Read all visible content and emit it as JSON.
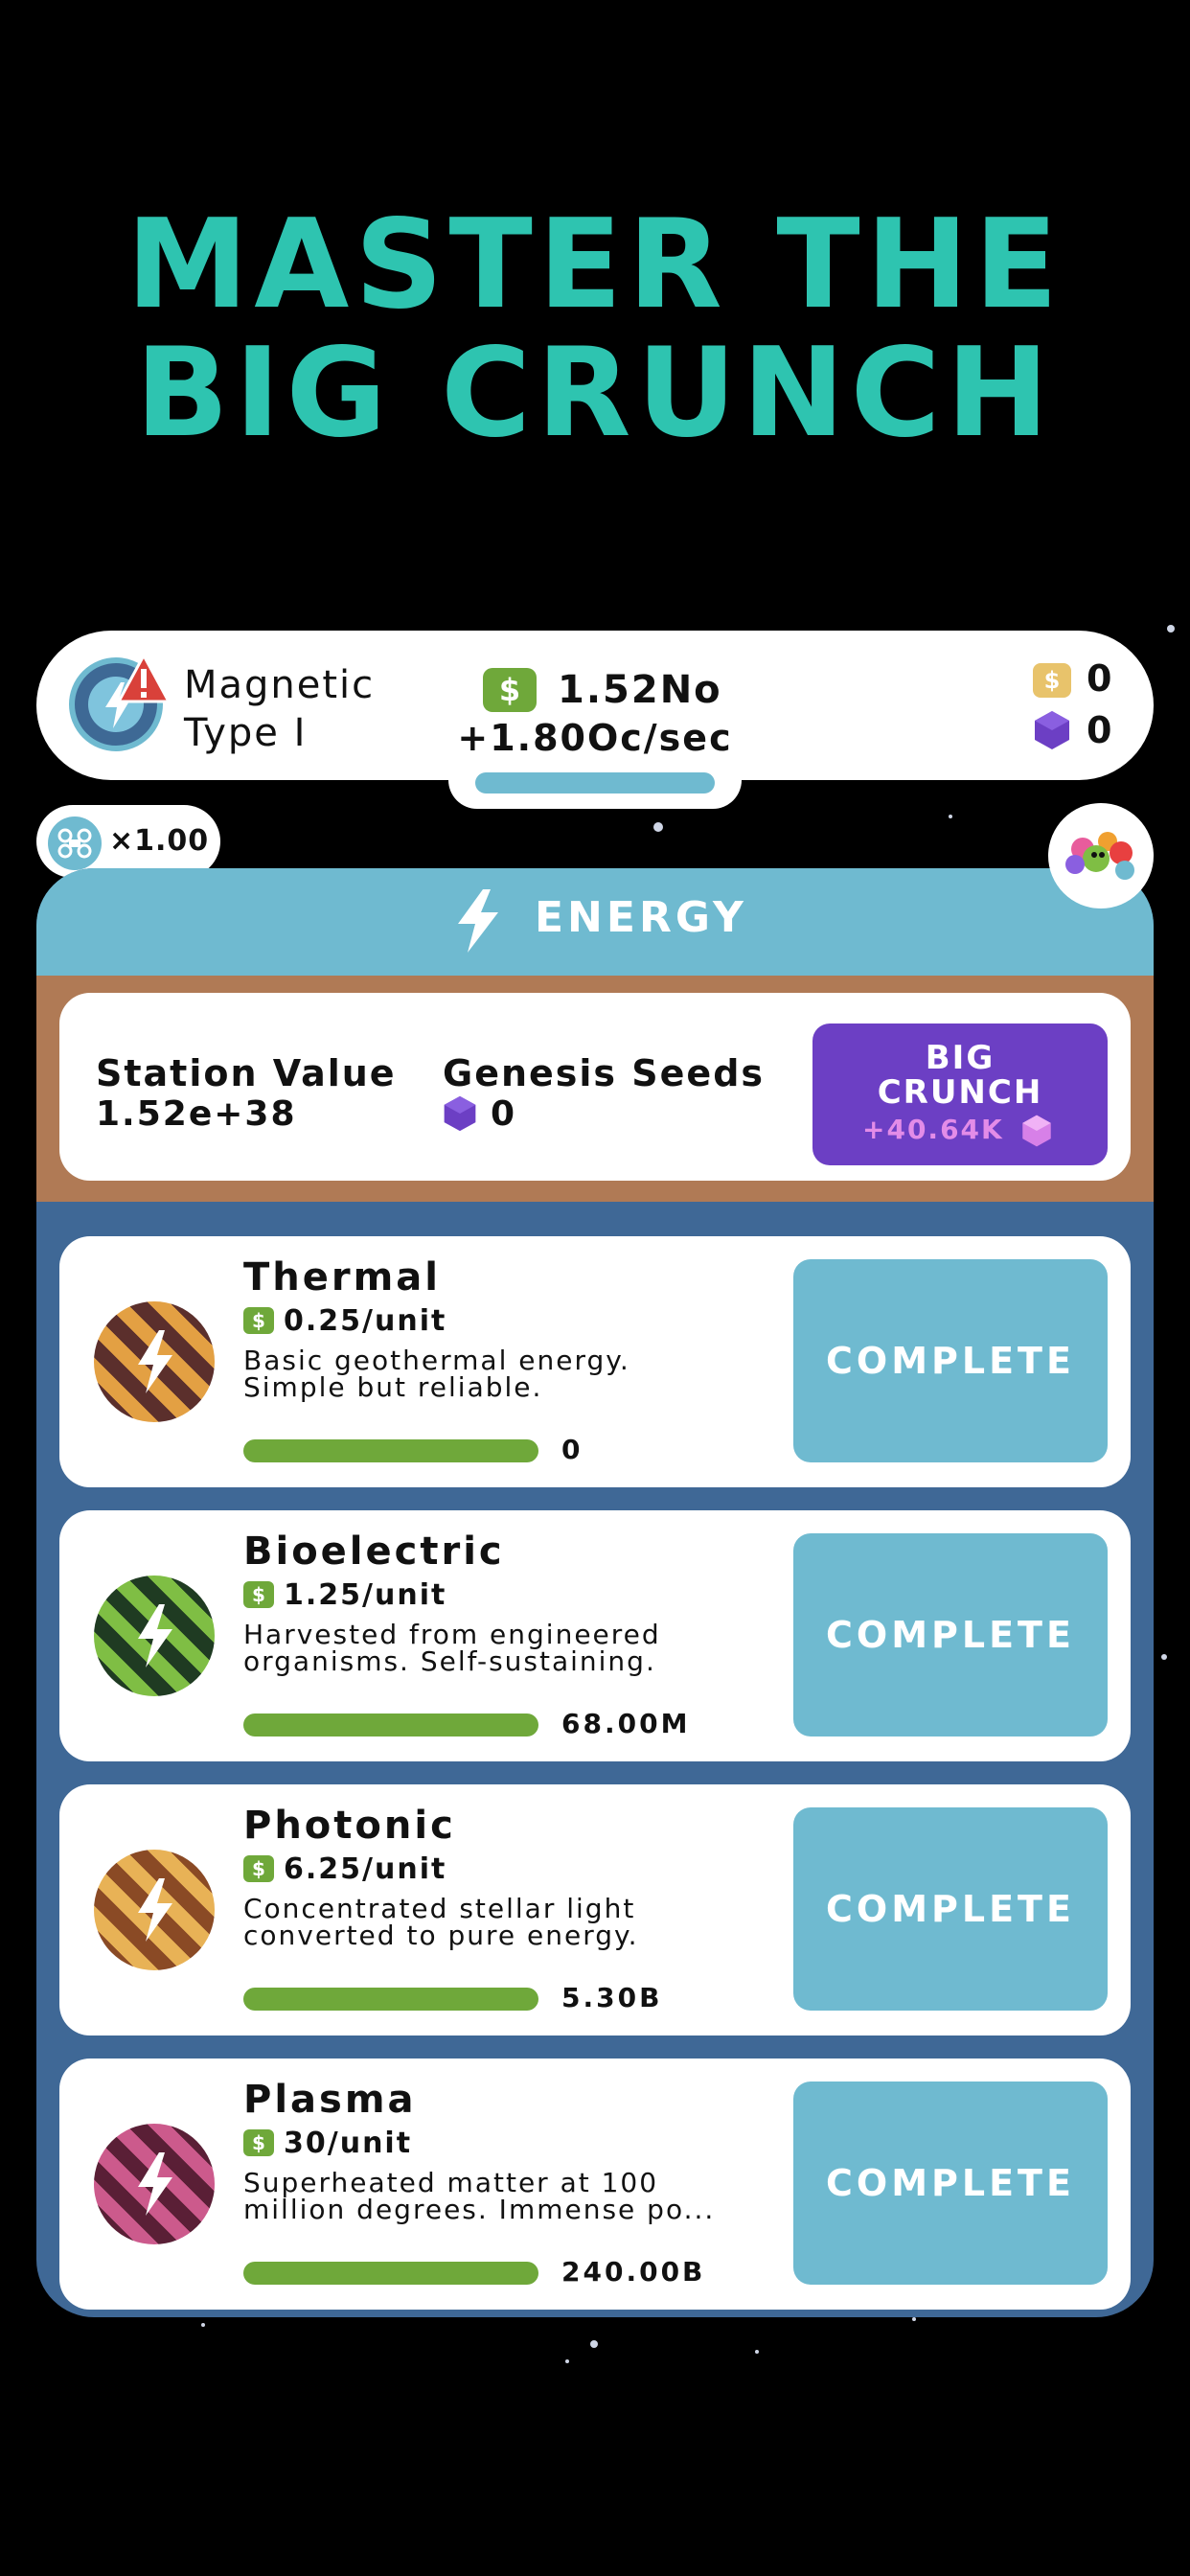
{
  "headline": {
    "line1": "MASTER THE",
    "line2": "BIG CRUNCH"
  },
  "top_bar": {
    "type_name_line1": "Magnetic",
    "type_name_line2": "Type I",
    "cash_symbol": "$",
    "cash_value": "1.52No",
    "income_rate": "+1.80Oc/sec",
    "gold_symbol": "$",
    "gold_count": "0",
    "gem_count": "0"
  },
  "multiplier": {
    "value": "×1.00"
  },
  "panel": {
    "title": "ENERGY",
    "station_value_label": "Station Value",
    "station_value": "1.52e+38",
    "genesis_seeds_label": "Genesis Seeds",
    "genesis_seeds": "0",
    "big_crunch_line1": "BIG",
    "big_crunch_line2": "CRUNCH",
    "big_crunch_reward": "+40.64K"
  },
  "cards": [
    {
      "name": "Thermal",
      "rate": "0.25/unit",
      "desc1": "Basic geothermal energy.",
      "desc2": "Simple but reliable.",
      "count": "0",
      "button": "COMPLETE"
    },
    {
      "name": "Bioelectric",
      "rate": "1.25/unit",
      "desc1": "Harvested from engineered",
      "desc2": "organisms. Self-sustaining.",
      "count": "68.00M",
      "button": "COMPLETE"
    },
    {
      "name": "Photonic",
      "rate": "6.25/unit",
      "desc1": "Concentrated stellar light",
      "desc2": "converted to pure energy.",
      "count": "5.30B",
      "button": "COMPLETE"
    },
    {
      "name": "Plasma",
      "rate": "30/unit",
      "desc1": "Superheated matter at 100",
      "desc2": "million degrees. Immense po...",
      "count": "240.00B",
      "button": "COMPLETE"
    }
  ],
  "colors": {
    "headline": "#2ec4b0",
    "accent_blue": "#6fbad0",
    "panel_blue": "#3f6896",
    "brown": "#b07a55",
    "purple": "#6c3fc4",
    "cash_green": "#6fa83a",
    "thermal": "#e3a043",
    "bioelectric": "#7fbe44",
    "photonic": "#e8b256",
    "plasma": "#cc5a8c"
  },
  "icons": {
    "type": "magnetic-type-icon",
    "warning": "warning-icon",
    "bolt": "lightning-bolt-icon",
    "gem": "gem-icon",
    "drone": "drone-icon",
    "avatar": "alien-avatar-icon"
  }
}
